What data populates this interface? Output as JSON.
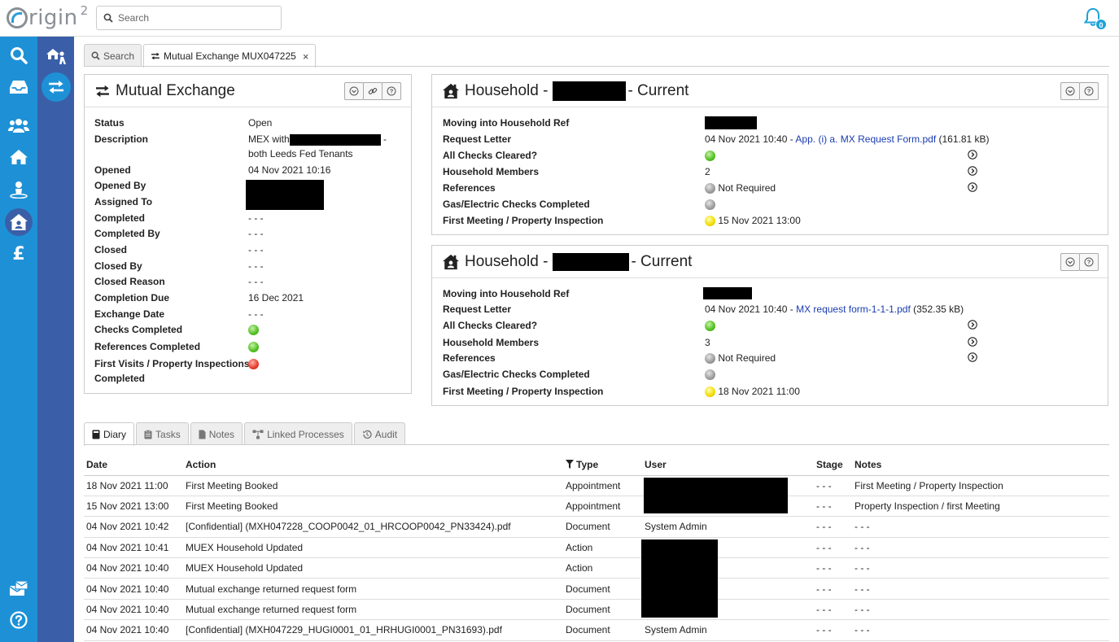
{
  "app": {
    "logo_text": "rigin",
    "logo_sup": "2"
  },
  "search": {
    "placeholder": "Search"
  },
  "notifications": {
    "count": "0"
  },
  "top_tabs": [
    {
      "label": "Search"
    },
    {
      "label": "Mutual Exchange MUX047225",
      "close": "×"
    }
  ],
  "mx_panel": {
    "title": "Mutual Exchange",
    "fields": {
      "status": {
        "label": "Status",
        "value": "Open"
      },
      "description": {
        "label": "Description",
        "value_prefix": "MEX with",
        "value_suffix": "-",
        "value_line2": "both Leeds Fed Tenants"
      },
      "opened": {
        "label": "Opened",
        "value": "04 Nov 2021 10:16"
      },
      "opened_by": {
        "label": "Opened By"
      },
      "assigned_to": {
        "label": "Assigned To"
      },
      "completed": {
        "label": "Completed",
        "value": "- - -"
      },
      "completed_by": {
        "label": "Completed By",
        "value": "- - -"
      },
      "closed": {
        "label": "Closed",
        "value": "- - -"
      },
      "closed_by": {
        "label": "Closed By",
        "value": "- - -"
      },
      "closed_reason": {
        "label": "Closed Reason",
        "value": "- - -"
      },
      "completion_due": {
        "label": "Completion Due",
        "value": "16 Dec 2021"
      },
      "exchange_date": {
        "label": "Exchange Date",
        "value": "- - -"
      },
      "checks_completed": {
        "label": "Checks Completed",
        "status": "green"
      },
      "references_completed": {
        "label": "References Completed",
        "status": "green"
      },
      "first_visits": {
        "label": "First Visits / Property Inspections",
        "label2": "Completed",
        "status": "red"
      }
    }
  },
  "households": [
    {
      "title_prefix": "Household -",
      "title_suffix": "- Current",
      "moving_ref": {
        "label": "Moving into Household Ref"
      },
      "request_letter": {
        "label": "Request Letter",
        "date": "04 Nov 2021 10:40 - ",
        "file": "App. (i) a. MX Request Form.pdf",
        "size": " (161.81 kB)"
      },
      "all_checks": {
        "label": "All Checks Cleared?",
        "status": "green"
      },
      "members": {
        "label": "Household Members",
        "value": "2"
      },
      "references": {
        "label": "References",
        "value": "Not Required",
        "status": "grey"
      },
      "gas_electric": {
        "label": "Gas/Electric Checks Completed",
        "status": "grey"
      },
      "first_meeting": {
        "label": "First Meeting / Property Inspection",
        "value": "15 Nov 2021 13:00",
        "status": "yellow"
      }
    },
    {
      "title_prefix": "Household -",
      "title_suffix": "- Current",
      "moving_ref": {
        "label": "Moving into Household Ref"
      },
      "request_letter": {
        "label": "Request Letter",
        "date": "04 Nov 2021 10:40 - ",
        "file": "MX request form-1-1-1.pdf",
        "size": " (352.35 kB)"
      },
      "all_checks": {
        "label": "All Checks Cleared?",
        "status": "green"
      },
      "members": {
        "label": "Household Members",
        "value": "3"
      },
      "references": {
        "label": "References",
        "value": "Not Required",
        "status": "grey"
      },
      "gas_electric": {
        "label": "Gas/Electric Checks Completed",
        "status": "grey"
      },
      "first_meeting": {
        "label": "First Meeting / Property Inspection",
        "value": "18 Nov 2021 11:00",
        "status": "yellow"
      }
    }
  ],
  "bottom_tabs": [
    {
      "label": "Diary"
    },
    {
      "label": "Tasks"
    },
    {
      "label": "Notes"
    },
    {
      "label": "Linked Processes"
    },
    {
      "label": "Audit"
    }
  ],
  "diary": {
    "columns": [
      "Date",
      "Action",
      "Type",
      "User",
      "Stage",
      "Notes"
    ],
    "rows": [
      {
        "date": "18 Nov 2021 11:00",
        "action": "First Meeting Booked",
        "type": "Appointment",
        "user": "",
        "stage": "- - -",
        "notes": "First Meeting / Property Inspection"
      },
      {
        "date": "15 Nov 2021 13:00",
        "action": "First Meeting Booked",
        "type": "Appointment",
        "user": "",
        "stage": "- - -",
        "notes": "Property Inspection / first Meeting"
      },
      {
        "date": "04 Nov 2021 10:42",
        "action": "[Confidential] (MXH047228_COOP0042_01_HRCOOP0042_PN33424).pdf",
        "type": "Document",
        "user": "System Admin",
        "stage": "- - -",
        "notes": "- - -"
      },
      {
        "date": "04 Nov 2021 10:41",
        "action": "MUEX Household Updated",
        "type": "Action",
        "user": "",
        "stage": "- - -",
        "notes": "- - -"
      },
      {
        "date": "04 Nov 2021 10:40",
        "action": "MUEX Household Updated",
        "type": "Action",
        "user": "",
        "stage": "- - -",
        "notes": "- - -"
      },
      {
        "date": "04 Nov 2021 10:40",
        "action": "Mutual exchange returned request form",
        "type": "Document",
        "user": "",
        "stage": "- - -",
        "notes": "- - -"
      },
      {
        "date": "04 Nov 2021 10:40",
        "action": "Mutual exchange returned request form",
        "type": "Document",
        "user": "",
        "stage": "- - -",
        "notes": "- - -"
      },
      {
        "date": "04 Nov 2021 10:40",
        "action": "[Confidential] (MXH047229_HUGI0001_01_HRHUGI0001_PN31693).pdf",
        "type": "Document",
        "user": "System Admin",
        "stage": "- - -",
        "notes": "- - -"
      }
    ]
  },
  "colors": {
    "sidebar_primary": "#1e91d6",
    "sidebar_secondary": "#3a5fa8",
    "link": "#1a3cb0"
  }
}
